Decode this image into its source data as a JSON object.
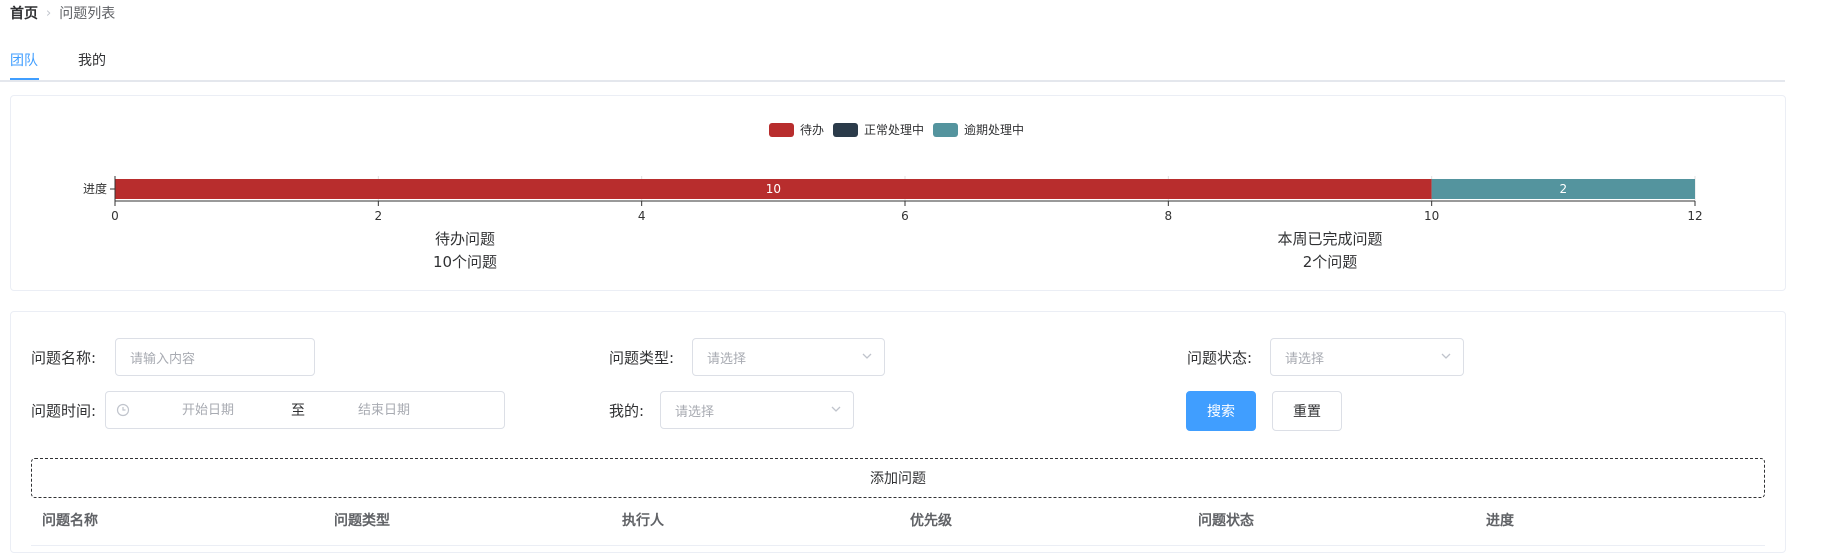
{
  "breadcrumb": {
    "home": "首页",
    "separator": "›",
    "current": "问题列表"
  },
  "tabs": [
    {
      "label": "团队",
      "active": true
    },
    {
      "label": "我的",
      "active": false
    }
  ],
  "chart_data": {
    "type": "bar",
    "orientation": "horizontal",
    "stacked": true,
    "categories": [
      "进度"
    ],
    "series": [
      {
        "name": "待办",
        "values": [
          10
        ],
        "color": "#b82d2d"
      },
      {
        "name": "正常处理中",
        "values": [
          0
        ],
        "color": "#2b3b4a"
      },
      {
        "name": "逾期处理中",
        "values": [
          2
        ],
        "color": "#54949e"
      }
    ],
    "data_labels": [
      "10",
      "2"
    ],
    "xlim": [
      0,
      12
    ],
    "xticks": [
      "0",
      "2",
      "4",
      "6",
      "8",
      "10",
      "12"
    ],
    "legend_position": "top-center",
    "grid": true
  },
  "summary": {
    "pending_title": "待办问题",
    "pending_count": "10个问题",
    "done_title": "本周已完成问题",
    "done_count": "2个问题"
  },
  "form": {
    "name_label": "问题名称:",
    "name_placeholder": "请输入内容",
    "type_label": "问题类型:",
    "type_placeholder": "请选择",
    "status_label": "问题状态:",
    "status_placeholder": "请选择",
    "time_label": "问题时间:",
    "start_placeholder": "开始日期",
    "range_separator": "至",
    "end_placeholder": "结束日期",
    "mine_label": "我的:",
    "mine_placeholder": "请选择",
    "search_button": "搜索",
    "reset_button": "重置"
  },
  "add_button": "添加问题",
  "table": {
    "columns": [
      "问题名称",
      "问题类型",
      "执行人",
      "优先级",
      "问题状态",
      "进度"
    ]
  },
  "colors": {
    "primary": "#409eff",
    "pending": "#b82d2d",
    "normal": "#2b3b4a",
    "overdue": "#54949e"
  }
}
